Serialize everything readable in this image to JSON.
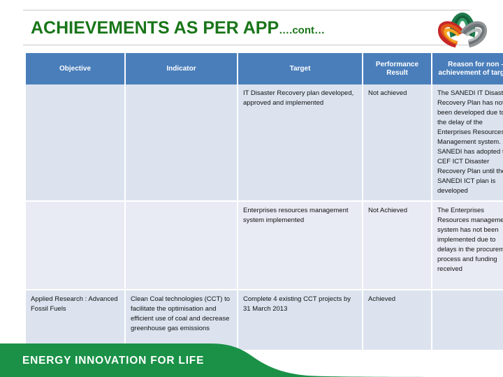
{
  "slide": {
    "title_main": "ACHIEVEMENTS AS PER APP",
    "title_cont": "….cont…",
    "title_color": "#197519",
    "background_color": "#ffffff"
  },
  "logo": {
    "name": "sanedi-trefoil-logo",
    "petal_colors": [
      "#1d7a4c",
      "#c62828",
      "#8e9396"
    ]
  },
  "table": {
    "header_background": "#4a7ebb",
    "header_text_color": "#ffffff",
    "row_shade_a": "#dce3ef",
    "row_shade_b": "#e8ebf4",
    "columns": [
      "Objective",
      "Indicator",
      "Target",
      "Performance Result",
      "Reason for non – achievement of targets"
    ],
    "headers": [
      {
        "label": "Objective"
      },
      {
        "label": "Indicator"
      },
      {
        "label": "Target"
      },
      {
        "label": "Performance Result"
      },
      {
        "label": "Reason for non – achievement of targets"
      }
    ],
    "rows": [
      {
        "objective": "",
        "indicator": "",
        "target": "IT Disaster Recovery plan developed, approved and implemented",
        "result": "Not achieved",
        "reason": "The SANEDI IT Disaster Recovery Plan has not been developed due to the delay of the Enterprises Resources Management system. SANEDI has adopted the CEF ICT Disaster Recovery Plan until the SANEDI ICT plan is developed"
      },
      {
        "objective": "",
        "indicator": "",
        "target": "Enterprises resources management system implemented",
        "result": "Not Achieved",
        "reason": "The Enterprises Resources management system has not been implemented  due to delays in the procurement process and funding received"
      },
      {
        "objective": "Applied Research : Advanced Fossil Fuels",
        "indicator": "Clean Coal technologies (CCT) to facilitate the optimisation and efficient use of coal and decrease greenhouse gas emissions",
        "target": "Complete  4 existing  CCT projects  by 31 March 2013",
        "result": "Achieved",
        "reason": ""
      }
    ]
  },
  "footer": {
    "tagline": "ENERGY INNOVATION FOR LIFE",
    "wave_color": "#1a9147",
    "text_color": "#ffffff"
  }
}
